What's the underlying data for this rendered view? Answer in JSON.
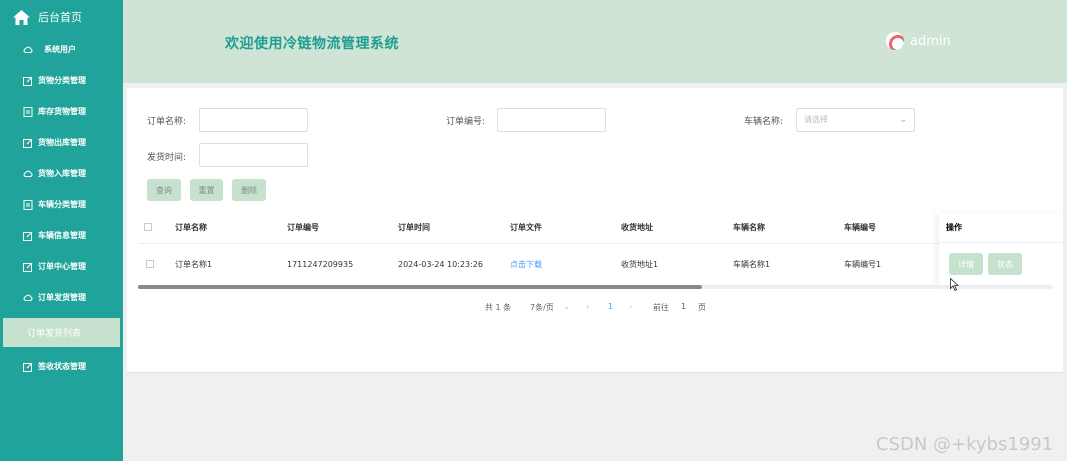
{
  "sidebar": {
    "home_label": "后台首页",
    "items": [
      {
        "label": "系统用户",
        "icon": "cloud-icon"
      },
      {
        "label": "货物分类管理",
        "icon": "edit-icon"
      },
      {
        "label": "库存货物管理",
        "icon": "document-icon"
      },
      {
        "label": "货物出库管理",
        "icon": "edit-icon"
      },
      {
        "label": "货物入库管理",
        "icon": "cloud-icon"
      },
      {
        "label": "车辆分类管理",
        "icon": "document-icon"
      },
      {
        "label": "车辆信息管理",
        "icon": "edit-icon"
      },
      {
        "label": "订单中心管理",
        "icon": "edit-icon"
      },
      {
        "label": "订单发货管理",
        "icon": "cloud-icon"
      }
    ],
    "active_sub": "订单发货列表",
    "last_item": {
      "label": "签收状态管理",
      "icon": "edit-icon"
    }
  },
  "header": {
    "title": "欢迎使用冷链物流管理系统",
    "user": "admin"
  },
  "search": {
    "order_name_label": "订单名称:",
    "order_no_label": "订单编号:",
    "vehicle_name_label": "车辆名称:",
    "vehicle_placeholder": "请选择",
    "ship_time_label": "发货时间:",
    "query_btn": "查询",
    "reset_btn": "重置",
    "delete_btn": "删除"
  },
  "table": {
    "headers": [
      "订单名称",
      "订单编号",
      "订单时间",
      "订单文件",
      "收货地址",
      "车辆名称",
      "车辆编号"
    ],
    "op_header": "操作",
    "rows": [
      {
        "name": "订单名称1",
        "no": "1711247209935",
        "time": "2024-03-24 10:23:26",
        "file": "点击下载",
        "address": "收货地址1",
        "vehicle": "车辆名称1",
        "vehicle_no": "车辆编号1"
      }
    ],
    "detail_btn": "详情",
    "status_btn": "状态"
  },
  "pagination": {
    "total": "共 1 条",
    "page_size": "7条/页",
    "current_page": "1",
    "goto_label": "前往",
    "goto_value": "1",
    "page_suffix": "页"
  },
  "watermark": "CSDN @+kybs1991",
  "colors": {
    "sidebar": "#20a39a",
    "header": "#cfe4d4",
    "button": "#c6e2ce",
    "title": "#1e9e93",
    "link": "#409eff"
  }
}
